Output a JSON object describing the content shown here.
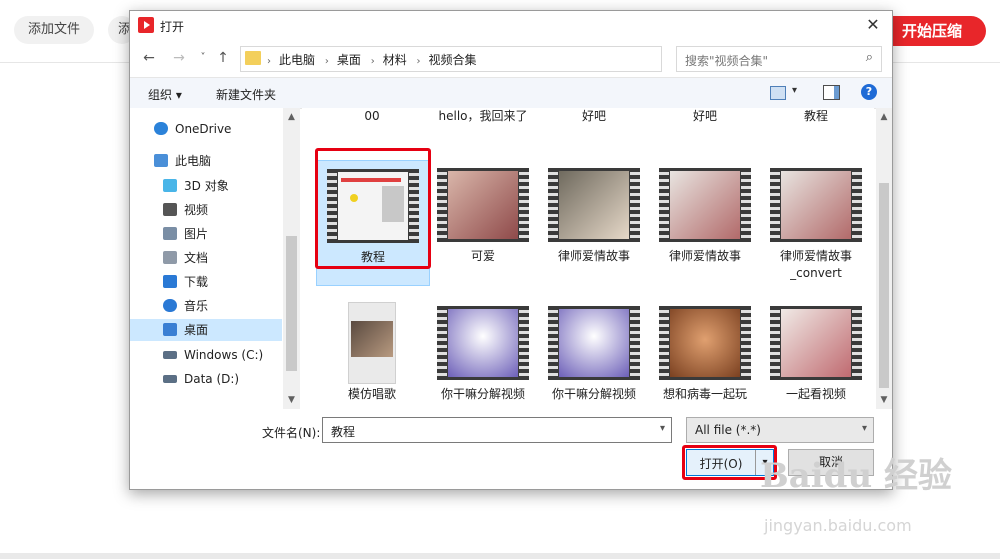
{
  "background": {
    "add_file": "添加文件",
    "partial_btn": "添",
    "start_compress": "开始压缩"
  },
  "dialog": {
    "title": "打开",
    "close": "✕",
    "nav": {
      "back": "←",
      "forward": "→",
      "recent": "˅",
      "up": "↑",
      "refresh": "↻"
    },
    "breadcrumbs": [
      "此电脑",
      "桌面",
      "材料",
      "视频合集"
    ],
    "search_placeholder": "搜索\"视频合集\"",
    "toolbar": {
      "organize": "组织 ▾",
      "new_folder": "新建文件夹",
      "help": "?"
    },
    "sidebar": [
      {
        "label": "OneDrive",
        "icon": "cloud-icon",
        "color": "#2b82d9"
      },
      {
        "label": "此电脑",
        "icon": "computer-icon",
        "color": "#4a8fd8"
      },
      {
        "label": "3D 对象",
        "icon": "cube-icon",
        "color": "#49b5e8"
      },
      {
        "label": "视频",
        "icon": "video-icon",
        "color": "#555555"
      },
      {
        "label": "图片",
        "icon": "picture-icon",
        "color": "#7a8ea5"
      },
      {
        "label": "文档",
        "icon": "document-icon",
        "color": "#8f9aa8"
      },
      {
        "label": "下载",
        "icon": "download-icon",
        "color": "#2a79d5"
      },
      {
        "label": "音乐",
        "icon": "music-icon",
        "color": "#2a79d5"
      },
      {
        "label": "桌面",
        "icon": "desktop-icon",
        "color": "#3a7fd3",
        "selected": true
      },
      {
        "label": "Windows (C:)",
        "icon": "drive-icon",
        "color": "#5b6f85"
      },
      {
        "label": "Data (D:)",
        "icon": "drive-icon",
        "color": "#5b6f85"
      }
    ],
    "files_row0": [
      "00",
      "hello，我回来了",
      "好吧",
      "好吧",
      "教程"
    ],
    "files_row1": [
      "教程",
      "可爱",
      "律师爱情故事",
      "律师爱情故事",
      "律师爱情故事\n_convert"
    ],
    "files_row2": [
      "模仿唱歌",
      "你干嘛分解视频",
      "你干嘛分解视频",
      "想和病毒一起玩",
      "一起看视频"
    ],
    "filename_label": "文件名(N):",
    "filename_value": "教程",
    "filetype": "All file (*.*)",
    "open": "打开(O)",
    "open_dropdown": "▾",
    "cancel": "取消"
  },
  "watermark": {
    "brand": "Baidu 经验",
    "url": "jingyan.baidu.com"
  },
  "colors": {
    "accent_red": "#e60012",
    "selection": "#cce8ff",
    "brand_red": "#e8262a"
  }
}
